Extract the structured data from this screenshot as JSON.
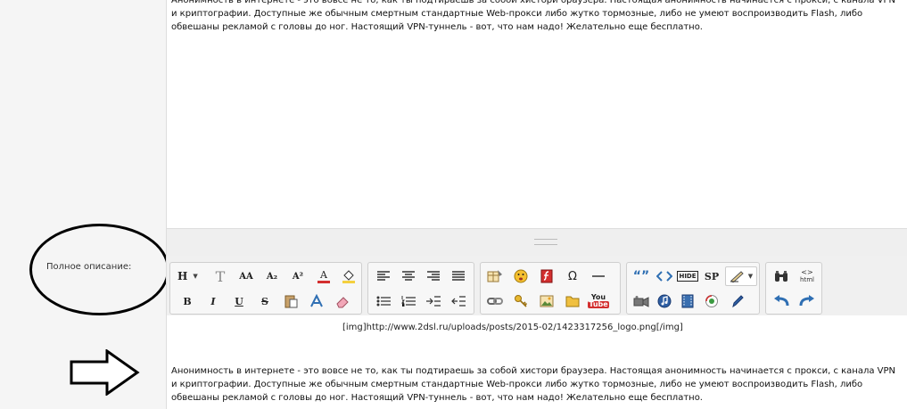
{
  "form": {
    "full_description_label": "Полное описание:"
  },
  "editor": {
    "top_text": "Анонимность в интернете - это вовсе не то, как ты подтираешь за собой хистори браузера. Настоящая анонимность начинается с прокси, с канала VPN и криптографии. Доступные же обычным смертным стандартные Web-прокси либо жутко тормозные, либо не умеют воспроизводить Flash, либо обвешаны рекламой с головы до ног. Настоящий VPN-туннель - вот, что нам надо! Желательно еще бесплатно.",
    "img_tag": "[img]http://www.2dsl.ru/uploads/posts/2015-02/1423317256_logo.png[/img]",
    "bottom_text": "Анонимность в интернете - это вовсе не то, как ты подтираешь за собой хистори браузера. Настоящая анонимность начинается с прокси, с канала VPN и криптографии. Доступные же обычным смертным стандартные Web-прокси либо жутко тормозные, либо не умеют воспроизводить Flash, либо обвешаны рекламой с головы до ног. Настоящий VPN-туннель - вот, что нам надо! Желательно еще бесплатно."
  },
  "toolbar": {
    "heading": "H",
    "font": "T",
    "font_size": "AA",
    "subscript": "A₂",
    "superscript": "A²",
    "text_color": "A",
    "bold": "B",
    "italic": "I",
    "underline": "U",
    "strike": "S",
    "omega": "Ω",
    "quote": "“”",
    "spoiler": "SP",
    "hide": "HIDE",
    "html": "html",
    "youtube_top": "You",
    "youtube_bottom": "Tube"
  },
  "colors": {
    "text_color_underline": "#d32f2f",
    "highlight": "#f4d03f",
    "accent_blue": "#2f6fb3"
  }
}
